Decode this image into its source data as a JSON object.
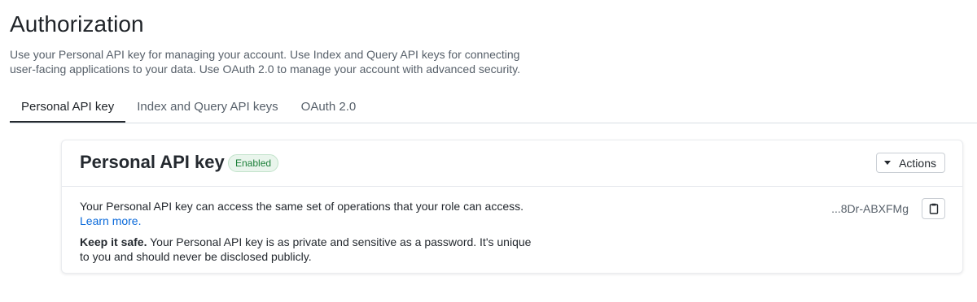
{
  "header": {
    "title": "Authorization",
    "description": "Use your Personal API key for managing your account. Use Index and Query API keys for connecting user-facing applications to your data. Use OAuth 2.0 to manage your account with advanced security."
  },
  "tabs": [
    {
      "label": "Personal API key",
      "active": true
    },
    {
      "label": "Index and Query API keys",
      "active": false
    },
    {
      "label": "OAuth 2.0",
      "active": false
    }
  ],
  "card": {
    "title": "Personal API key",
    "status": "Enabled",
    "actions_label": "Actions",
    "body_text": "Your Personal API key can access the same set of operations that your role can access.",
    "learn_more": "Learn more.",
    "keep_safe_bold": "Keep it safe.",
    "keep_safe_text": " Your Personal API key is as private and sensitive as a password. It's unique to you and should never be disclosed publicly.",
    "masked_key": "...8Dr-ABXFMg"
  },
  "icons": {
    "actions_caret": "caret-down-icon",
    "copy": "clipboard-icon"
  },
  "colors": {
    "link": "#0969da",
    "badge_text": "#1a7f37",
    "badge_bg": "#e9f5ec"
  }
}
